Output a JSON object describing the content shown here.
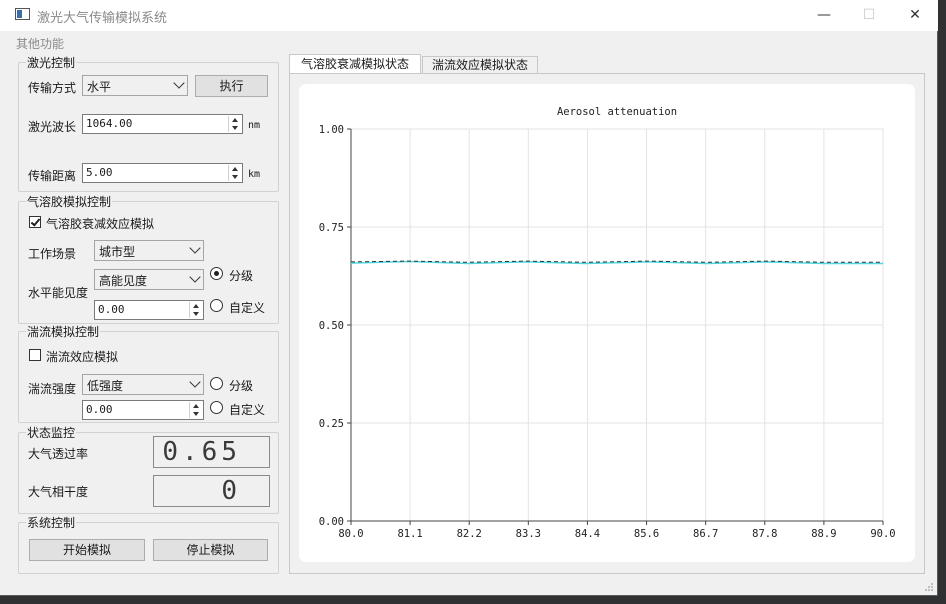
{
  "window": {
    "title": "激光大气传输模拟系统",
    "minimize_glyph": "—",
    "maximize_glyph": "☐",
    "close_glyph": "✕"
  },
  "menu": {
    "items": [
      "其他功能"
    ]
  },
  "laser": {
    "legend": "激光控制",
    "mode_label": "传输方式",
    "mode_value": "水平",
    "execute_label": "执行",
    "wavelength_label": "激光波长",
    "wavelength_value": "1064.00",
    "wavelength_unit": "nm",
    "distance_label": "传输距离",
    "distance_value": "5.00",
    "distance_unit": "km"
  },
  "aerosol": {
    "legend": "气溶胶模拟控制",
    "enable_label": "气溶胶衰减效应模拟",
    "enabled": true,
    "scene_label": "工作场景",
    "scene_value": "城市型",
    "visibility_label": "水平能见度",
    "visibility_value": "高能见度",
    "visibility_custom_value": "0.00",
    "radio_graded": "分级",
    "radio_custom": "自定义",
    "selected": "graded"
  },
  "turbulence": {
    "legend": "湍流模拟控制",
    "enable_label": "湍流效应模拟",
    "enabled": false,
    "strength_label": "湍流强度",
    "strength_value": "低强度",
    "strength_custom_value": "0.00",
    "radio_graded": "分级",
    "radio_custom": "自定义",
    "selected": "none"
  },
  "status": {
    "legend": "状态监控",
    "transmittance_label": "大气透过率",
    "transmittance_value": "0.65",
    "coherence_label": "大气相干度",
    "coherence_value": "0"
  },
  "system": {
    "legend": "系统控制",
    "start_label": "开始模拟",
    "stop_label": "停止模拟"
  },
  "tabs": [
    {
      "label": "气溶胶衰减模拟状态",
      "active": true
    },
    {
      "label": "湍流效应模拟状态",
      "active": false
    }
  ],
  "colors": {
    "line": "#4fd8e0",
    "dash": "#333333",
    "grid": "#e3e3e3"
  },
  "chart_data": {
    "type": "line",
    "title": "Aerosol attenuation",
    "xlabel": "",
    "ylabel": "",
    "xlim": [
      80.0,
      90.0
    ],
    "ylim": [
      0.0,
      1.0
    ],
    "x_ticks": [
      "80.0",
      "81.1",
      "82.2",
      "83.3",
      "84.4",
      "85.6",
      "86.7",
      "87.8",
      "88.9",
      "90.0"
    ],
    "y_ticks": [
      "0.00",
      "0.25",
      "0.50",
      "0.75",
      "1.00"
    ],
    "grid": true,
    "series": [
      {
        "style": "solid",
        "x": [
          80.0,
          81.1,
          82.2,
          83.3,
          84.4,
          85.6,
          86.7,
          87.8,
          88.9,
          90.0
        ],
        "y": [
          0.658,
          0.662,
          0.657,
          0.661,
          0.657,
          0.661,
          0.657,
          0.661,
          0.657,
          0.657
        ]
      },
      {
        "style": "dashed",
        "x": [
          80.0,
          81.1,
          82.2,
          83.3,
          84.4,
          85.6,
          86.7,
          87.8,
          88.9,
          90.0
        ],
        "y": [
          0.661,
          0.663,
          0.66,
          0.663,
          0.66,
          0.663,
          0.66,
          0.663,
          0.66,
          0.66
        ]
      }
    ]
  }
}
